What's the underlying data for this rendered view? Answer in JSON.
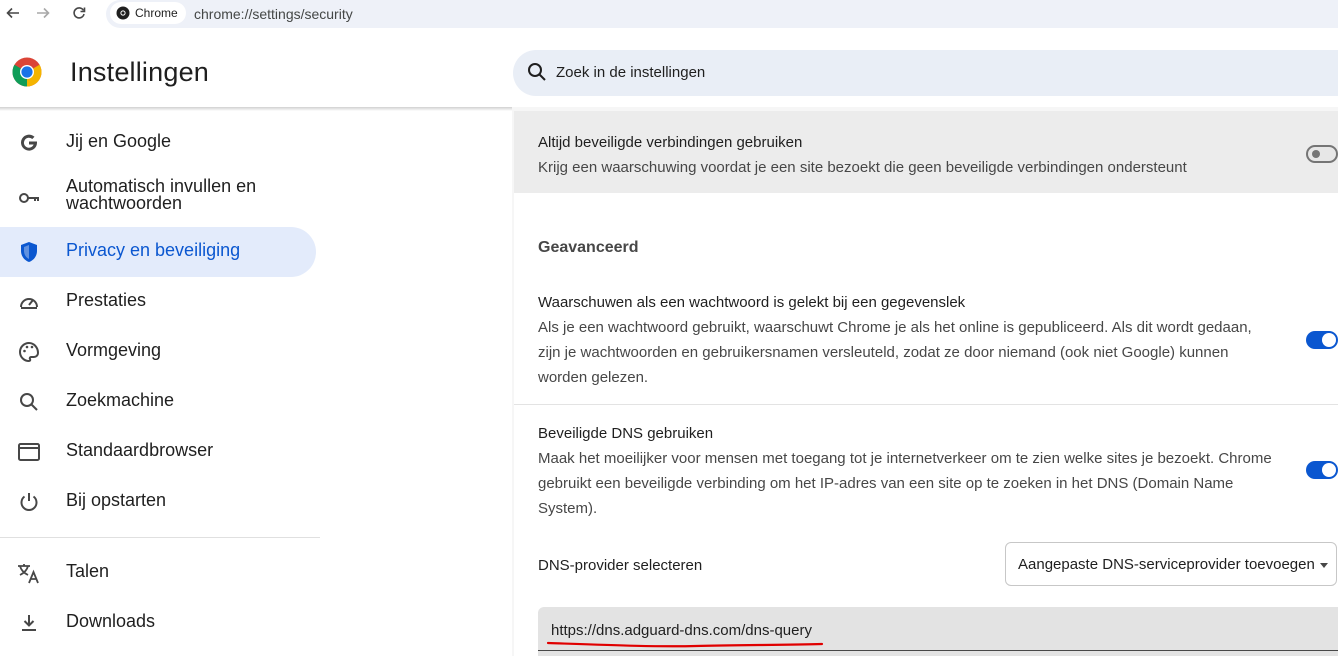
{
  "browser": {
    "chip_label": "Chrome",
    "url": "chrome://settings/security"
  },
  "header": {
    "title": "Instellingen",
    "search_placeholder": "Zoek in de instellingen"
  },
  "sidebar": {
    "items": [
      {
        "label": "Jij en Google",
        "icon": "google-g-icon"
      },
      {
        "label": "Automatisch invullen en wachtwoorden",
        "icon": "key-icon"
      },
      {
        "label": "Privacy en beveiliging",
        "icon": "shield-icon",
        "active": true
      },
      {
        "label": "Prestaties",
        "icon": "speedometer-icon"
      },
      {
        "label": "Vormgeving",
        "icon": "palette-icon"
      },
      {
        "label": "Zoekmachine",
        "icon": "search-icon"
      },
      {
        "label": "Standaardbrowser",
        "icon": "browser-window-icon"
      },
      {
        "label": "Bij opstarten",
        "icon": "power-icon"
      },
      {
        "label": "Talen",
        "icon": "translate-icon"
      },
      {
        "label": "Downloads",
        "icon": "download-icon"
      }
    ]
  },
  "main": {
    "secure_connections": {
      "title": "Altijd beveiligde verbindingen gebruiken",
      "description": "Krijg een waarschuwing voordat je een site bezoekt die geen beveiligde verbindingen ondersteunt",
      "enabled": false
    },
    "advanced_heading": "Geavanceerd",
    "password_leak": {
      "title": "Waarschuwen als een wachtwoord is gelekt bij een gegevenslek",
      "description": "Als je een wachtwoord gebruikt, waarschuwt Chrome je als het online is gepubliceerd. Als dit wordt gedaan, zijn je wachtwoorden en gebruikersnamen versleuteld, zodat ze door niemand (ook niet Google) kunnen worden gelezen.",
      "enabled": true
    },
    "secure_dns": {
      "title": "Beveiligde DNS gebruiken",
      "description": "Maak het moeilijker voor mensen met toegang tot je internetverkeer om te zien welke sites je bezoekt. Chrome gebruikt een beveiligde verbinding om het IP-adres van een site op te zoeken in het DNS (Domain Name System).",
      "enabled": true
    },
    "dns_provider": {
      "label": "DNS-provider selecteren",
      "selected": "Aangepaste DNS-serviceprovider toevoegen",
      "custom_url": "https://dns.adguard-dns.com/dns-query"
    }
  },
  "colors": {
    "accent": "#0b57d0",
    "active_bg": "#e3ebfb",
    "annotation": "#e00000"
  }
}
